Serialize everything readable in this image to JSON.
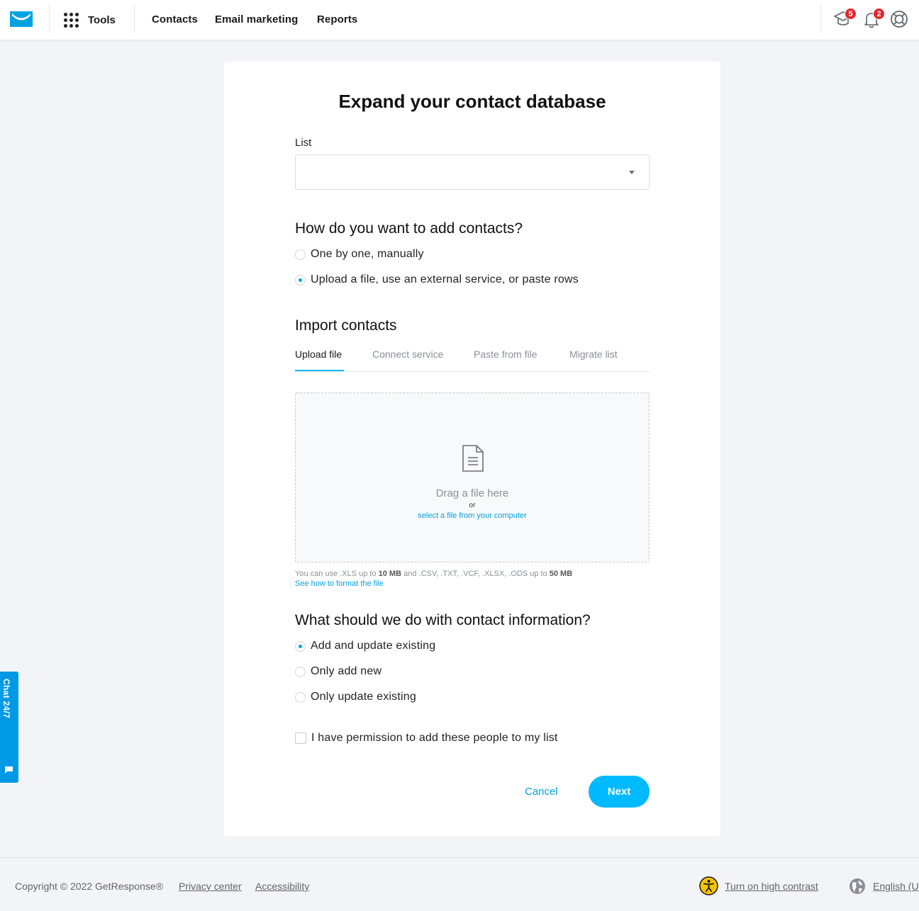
{
  "header": {
    "tools_label": "Tools",
    "nav": [
      "Contacts",
      "Email marketing",
      "Reports"
    ],
    "learning_badge": "5",
    "notifications_badge": "2"
  },
  "card": {
    "title": "Expand your contact database",
    "list_label": "List",
    "list_value": "",
    "how_heading": "How do you want to add contacts?",
    "how_options": [
      {
        "label": "One by one, manually",
        "selected": false
      },
      {
        "label": "Upload a file, use an external service, or paste rows",
        "selected": true
      }
    ],
    "import_heading": "Import contacts",
    "tabs": [
      {
        "label": "Upload file",
        "active": true
      },
      {
        "label": "Connect service",
        "active": false
      },
      {
        "label": "Paste from file",
        "active": false
      },
      {
        "label": "Migrate list",
        "active": false
      }
    ],
    "dropzone": {
      "drag_text": "Drag a file here",
      "or_text": "or",
      "select_link": "select a file from your computer"
    },
    "hint": {
      "prefix": "You can use .XLS up to",
      "xls_limit": "10 MB",
      "middle": "and .CSV, .TXT, .VCF, .XLSX, .ODS up to",
      "other_limit": "50 MB",
      "link": "See how to format the file"
    },
    "info_heading": "What should we do with contact information?",
    "info_options": [
      {
        "label": "Add and update existing",
        "selected": true
      },
      {
        "label": "Only add new",
        "selected": false
      },
      {
        "label": "Only update existing",
        "selected": false
      }
    ],
    "permission_label": "I have permission to add these people to my list",
    "permission_checked": false,
    "cancel_label": "Cancel",
    "next_label": "Next"
  },
  "chat_tab": "Chat 24/7",
  "footer": {
    "copyright": "Copyright © 2022 GetResponse®",
    "privacy": "Privacy center",
    "accessibility": "Accessibility",
    "contrast": "Turn on high contrast",
    "language": "English (U"
  },
  "colors": {
    "accent": "#00baff",
    "link": "#00a2e2",
    "badge": "#e5262b"
  }
}
